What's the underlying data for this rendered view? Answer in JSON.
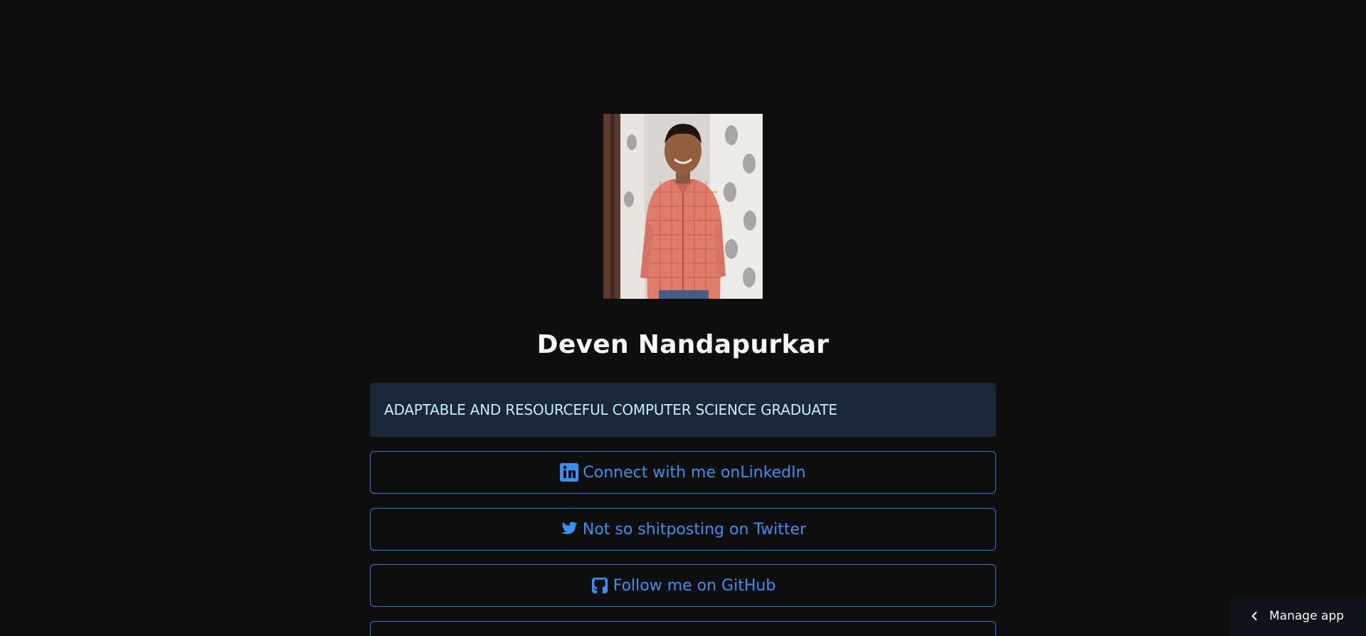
{
  "profile": {
    "photo_icon": "profile-photo",
    "name": "Deven Nandapurkar",
    "tagline": "ADAPTABLE AND RESOURCEFUL COMPUTER SCIENCE GRADUATE"
  },
  "links": [
    {
      "label": "Connect with me onLinkedIn",
      "icon": "linkedin-icon"
    },
    {
      "label": "Not so shitposting on Twitter",
      "icon": "twitter-icon"
    },
    {
      "label": "Follow me on GitHub",
      "icon": "github-icon"
    },
    {
      "label": "",
      "icon": ""
    }
  ],
  "manage_app": {
    "label": "Manage app",
    "icon": "chevron-left-icon"
  },
  "colors": {
    "background": "#0e0e0f",
    "accent": "#3a8ff0",
    "tagline_bg": "#1a2838",
    "tagline_text": "#c7ebff"
  }
}
